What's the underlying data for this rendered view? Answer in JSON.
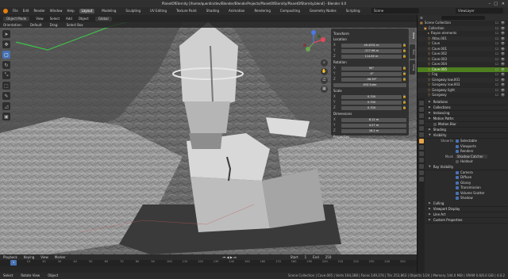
{
  "titlebar": {
    "title": "PlanetOfEternity [/home/quentin/dev/Blender/BlenderProjects/PlanetOfEternity/PlanetOfEternity.blend] - Blender 4.0"
  },
  "menubar": {
    "menus": [
      "File",
      "Edit",
      "Render",
      "Window",
      "Help"
    ],
    "workspaces": [
      {
        "label": "Layout",
        "active": true
      },
      {
        "label": "Modeling"
      },
      {
        "label": "Sculpting"
      },
      {
        "label": "UV Editing"
      },
      {
        "label": "Texture Paint"
      },
      {
        "label": "Shading"
      },
      {
        "label": "Animation"
      },
      {
        "label": "Rendering"
      },
      {
        "label": "Compositing"
      },
      {
        "label": "Geometry Nodes"
      },
      {
        "label": "Scripting"
      }
    ],
    "scene": "Scene",
    "view_layer": "ViewLayer"
  },
  "viewport": {
    "header": {
      "mode": "Object Mode",
      "items": [
        "View",
        "Select",
        "Add",
        "Object"
      ],
      "orientation": "Global"
    },
    "tool_header": {
      "items": [
        "Orientation:",
        "Default",
        "Drag:",
        "Select Box"
      ]
    },
    "tools": [
      {
        "icon": "cursor-icon",
        "glyph": "➤"
      },
      {
        "icon": "move-icon",
        "glyph": "✥"
      },
      {
        "icon": "select-icon",
        "glyph": "▢",
        "active": true
      },
      {
        "icon": "rotate-icon",
        "glyph": "↻"
      },
      {
        "icon": "scale-icon",
        "glyph": "⤡"
      },
      {
        "icon": "transform-icon",
        "glyph": "⬚"
      },
      {
        "icon": "annotate-icon",
        "glyph": "✎"
      },
      {
        "icon": "measure-icon",
        "glyph": "◿"
      },
      {
        "icon": "add-cube-icon",
        "glyph": "▣"
      }
    ],
    "npanel": {
      "title": "Transform",
      "location": {
        "label": "Location",
        "x": "49.4331 m",
        "y": "-217.96 m",
        "z": "114.85 m"
      },
      "rotation": {
        "label": "Rotation",
        "x": "90°",
        "y": "-0°",
        "z": "-58.39°"
      },
      "rotation_mode": "XYZ Euler",
      "scale": {
        "label": "Scale",
        "x": "0.700",
        "y": "0.700",
        "z": "0.700"
      },
      "dimensions": {
        "label": "Dimensions",
        "x": "8.12 m",
        "y": "4.27 m",
        "z": "16.2 m"
      },
      "properties_label": "Properties",
      "tabs": [
        "Item",
        "Tool",
        "View"
      ]
    }
  },
  "timeline": {
    "header": [
      "Playback",
      "Keying",
      "View",
      "Marker"
    ],
    "frame_start": "1",
    "frame_end": "250",
    "current_frame": "1",
    "ticks": [
      "0",
      "10",
      "20",
      "30",
      "40",
      "50",
      "60",
      "70",
      "80",
      "90",
      "100",
      "110",
      "120",
      "130",
      "140",
      "150",
      "160",
      "170",
      "180",
      "190",
      "200",
      "210",
      "220",
      "230",
      "240",
      "250"
    ]
  },
  "statusbar": {
    "items": [
      "Select",
      "Rotate View",
      "Object"
    ],
    "stats": "Scene Collection | Cave.005 | Verts 164,288 | Faces 149,374 | Tris 253,863 | Objects 1/24 | Memory 144.0 MiB | VRAM 0.6/6.0 GiB | 4.0.2"
  },
  "outliner": {
    "title": "Scene Collection",
    "items": [
      {
        "label": "Scene Collection",
        "indent": 0,
        "icon": "▦"
      },
      {
        "label": "Collection",
        "indent": 1,
        "icon": "▣"
      },
      {
        "label": "Rayon elements",
        "indent": 2,
        "icon": "▸"
      },
      {
        "label": "Atlas.001",
        "indent": 2,
        "icon": "▽"
      },
      {
        "label": "Cave",
        "indent": 2,
        "icon": "▽"
      },
      {
        "label": "Cave.001",
        "indent": 2,
        "icon": "▽"
      },
      {
        "label": "Cave.002",
        "indent": 2,
        "icon": "▽"
      },
      {
        "label": "Cave.003",
        "indent": 2,
        "icon": "▽"
      },
      {
        "label": "Cave.004",
        "indent": 2,
        "icon": "▽"
      },
      {
        "label": "Cave.005",
        "indent": 2,
        "icon": "▽",
        "selected": true
      },
      {
        "label": "Fog",
        "indent": 2,
        "icon": "▽"
      },
      {
        "label": "Gangway low.001",
        "indent": 2,
        "icon": "▽"
      },
      {
        "label": "Gangway low.003",
        "indent": 2,
        "icon": "▽"
      },
      {
        "label": "Gangway light",
        "indent": 2,
        "icon": "▽"
      },
      {
        "label": "Gangway",
        "indent": 2,
        "icon": "▽"
      }
    ]
  },
  "properties": {
    "sections": [
      {
        "type": "sec",
        "label": "Relations"
      },
      {
        "type": "sec",
        "label": "Collections"
      },
      {
        "type": "sec",
        "label": "Instancing"
      },
      {
        "type": "sec",
        "label": "Motion Paths"
      },
      {
        "type": "sub",
        "label": "Motion Blur"
      },
      {
        "type": "sec",
        "label": "Shading"
      },
      {
        "type": "sec",
        "label": "Visibility",
        "open": true
      },
      {
        "type": "check",
        "label": "Show In",
        "value": "Selectable"
      },
      {
        "type": "check",
        "label": "",
        "value": "Viewports"
      },
      {
        "type": "check",
        "label": "",
        "value": "Renders"
      },
      {
        "type": "select",
        "label": "Mask",
        "value": "Shadow Catcher"
      },
      {
        "type": "check",
        "label": "",
        "value": "Holdout",
        "off": true
      },
      {
        "type": "sec",
        "label": "Ray Visibility",
        "open": true
      },
      {
        "type": "check",
        "label": "",
        "value": "Camera"
      },
      {
        "type": "check",
        "label": "",
        "value": "Diffuse"
      },
      {
        "type": "check",
        "label": "",
        "value": "Glossy"
      },
      {
        "type": "check",
        "label": "",
        "value": "Transmission"
      },
      {
        "type": "check",
        "label": "",
        "value": "Volume Scatter"
      },
      {
        "type": "check",
        "label": "",
        "value": "Shadow"
      },
      {
        "type": "sec",
        "label": "Culling"
      },
      {
        "type": "sec",
        "label": "Viewport Display"
      },
      {
        "type": "sec",
        "label": "Line Art"
      },
      {
        "type": "sec",
        "label": "Custom Properties"
      }
    ]
  },
  "colors": {
    "accent": "#4772b3",
    "selected": "#4d7e1f",
    "orange": "#e87d0d"
  }
}
